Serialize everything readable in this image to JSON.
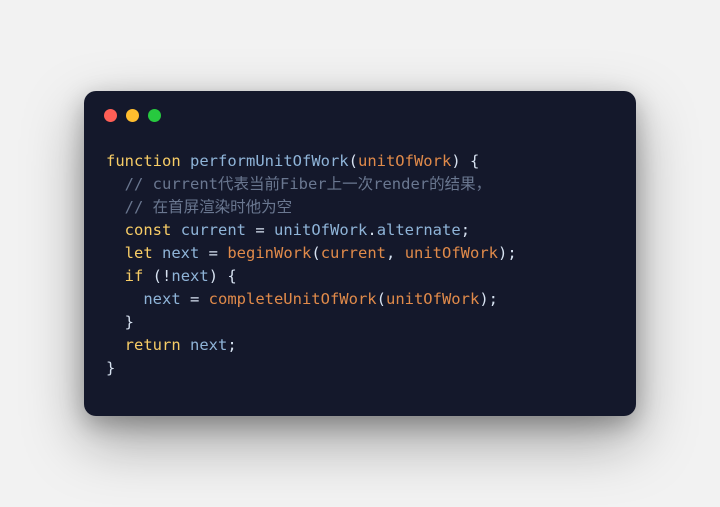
{
  "colors": {
    "window_bg": "#14182b",
    "page_bg": "#f2f2f2",
    "dot_red": "#ff5f56",
    "dot_yellow": "#ffbd2e",
    "dot_green": "#27c93f",
    "keyword": "#f7cc66",
    "identifier": "#8fb4d8",
    "call": "#e08a4a",
    "comment": "#6a7790",
    "default_text": "#d6e1f0"
  },
  "tokens": {
    "kw_function": "function",
    "fn_name": "performUnitOfWork",
    "p_open1": "(",
    "param1": "unitOfWork",
    "p_close1": ") {",
    "comment1": "  // current代表当前Fiber上一次render的结果，",
    "comment2": "  // 在首屏渲染时他为空",
    "indent1": "  ",
    "kw_const": "const",
    "sp": " ",
    "id_current": "current",
    "sp_eq_sp": " = ",
    "id_unitOfWork": "unitOfWork",
    "dot": ".",
    "id_alternate": "alternate",
    "semi": ";",
    "kw_let": "let",
    "id_next": "next",
    "call_beginWork": "beginWork",
    "p_open2": "(",
    "arg_current": "current",
    "comma_sp": ", ",
    "arg_unitOfWork": "unitOfWork",
    "p_close_semi": ");",
    "kw_if": "if",
    "sp_p_open": " (",
    "bang": "!",
    "id_next2": "next",
    "p_close_brace": ") {",
    "indent2": "    ",
    "id_next3": "next",
    "call_completeUnitOfWork": "completeUnitOfWork",
    "p_open3": "(",
    "arg_unitOfWork2": "unitOfWork",
    "p_close_semi2": ");",
    "brace_close_inner": "  }",
    "kw_return": "return",
    "id_next4": "next",
    "brace_close_outer": "}"
  }
}
